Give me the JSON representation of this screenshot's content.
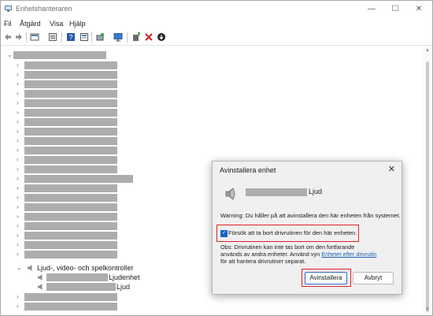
{
  "window": {
    "title": "Enhetshanteraren"
  },
  "title_controls": {
    "minimize": "—",
    "maximize": "☐",
    "close": "✕"
  },
  "menu": [
    "Fil",
    "Åtgärd",
    "Visa",
    "Hjälp"
  ],
  "toolbar_icons": [
    "back-icon",
    "forward-icon",
    "computer-properties-icon",
    "list-icon",
    "help-icon",
    "properties-icon",
    "scan-hardware-icon",
    "monitor-icon",
    "add-driver-icon",
    "uninstall-icon",
    "update-driver-icon"
  ],
  "tree": {
    "expanded_category": "Ljud-, video- och spelkontroller",
    "child_1_suffix": "Ljudenhet",
    "child_2_suffix": "Ljud"
  },
  "dialog": {
    "title": "Avinstallera enhet",
    "close": "✕",
    "device_name_suffix": "Ljud",
    "warning": "Warning: Du håller på att avinstallera den här enheten från systemet.",
    "checkbox_label": "Försök att ta bort drivrutinen för den här enheten.",
    "checkbox_checked": true,
    "note_line1": "Obs: Drivrutinen kan inte tas bort om den fortfarande",
    "note_line2_pre": "används av andra enheter. Använd vyn ",
    "note_link": "Enheter efter drivrutin",
    "note_line3": "för att hantera drivrutiner separat.",
    "uninstall_button": "Avinstallera",
    "cancel_button": "Avbryt"
  }
}
